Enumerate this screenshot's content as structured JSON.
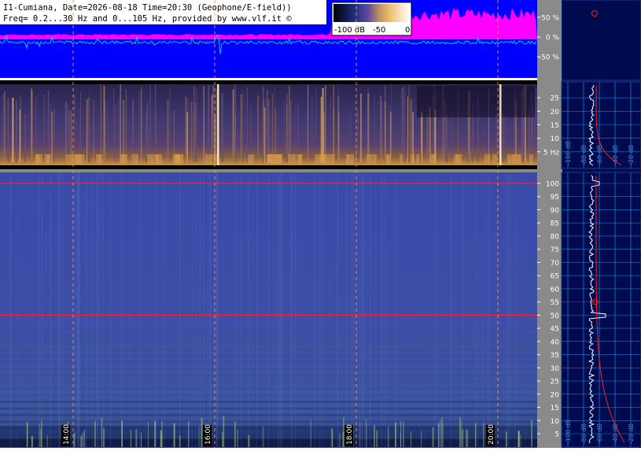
{
  "header": {
    "line1": "I1-Cumiana, Date=2026-08-18 Time=20:30 (Geophone/E-field))",
    "line2": "Freq= 0.2...30 Hz and 0...105 Hz, provided by www.vlf.it ©"
  },
  "colorbar": {
    "labels": [
      "-100 dB",
      "-50",
      "0"
    ]
  },
  "colors": {
    "sidebar_bg": "#000a4e",
    "amplitude_bg": "#0000ff",
    "amplitude_upper": "#ff00ff",
    "amplitude_trace": "#00c8d0",
    "ruler_bg": "#8a8a8a",
    "spectrum_gridline": "#1e78d0",
    "marker_red": "#ff2020",
    "hour_marker": "#ff9a4a"
  },
  "chart_data": [
    {
      "type": "line",
      "name": "amplitude",
      "y_tick_labels": [
        "50 %",
        "0 %",
        "-50 %"
      ],
      "y_ticks": [
        50,
        0,
        -50
      ],
      "ylim": [
        -100,
        100
      ]
    },
    {
      "type": "heatmap",
      "name": "spectrogram-low",
      "y_tick_labels": [
        "25",
        "20",
        "15",
        "10",
        "5 Hz"
      ],
      "y_ticks": [
        25,
        20,
        15,
        10,
        5
      ],
      "ylim": [
        0,
        30
      ]
    },
    {
      "type": "heatmap",
      "name": "spectrogram-high",
      "y_tick_labels": [
        "100",
        "95",
        "90",
        "85",
        "80",
        "75",
        "70",
        "65",
        "60",
        "55",
        "50",
        "45",
        "40",
        "35",
        "30",
        "25",
        "20",
        "15",
        "10",
        "5"
      ],
      "y_ticks": [
        100,
        95,
        90,
        85,
        80,
        75,
        70,
        65,
        60,
        55,
        50,
        45,
        40,
        35,
        30,
        25,
        20,
        15,
        10,
        5
      ],
      "ylim": [
        0,
        105
      ],
      "red_lines_hz": [
        100,
        50
      ]
    },
    {
      "type": "line",
      "name": "time-axis",
      "time_labels": [
        "14:00",
        "16:00",
        "18:00",
        "20:00"
      ],
      "hour_markers": [
        "14:00",
        "16:00",
        "18:00",
        "20:00"
      ]
    },
    {
      "type": "line",
      "name": "spectrum-profile-low",
      "x_tick_labels": [
        "-100 dB",
        "-80 dB",
        "-60 dB",
        "-40 dB",
        "-20 dB"
      ]
    },
    {
      "type": "line",
      "name": "spectrum-profile-high",
      "x_tick_labels": [
        "-100 dB",
        "-80 dB",
        "-60 dB",
        "-40 dB",
        "-20 dB"
      ]
    }
  ]
}
